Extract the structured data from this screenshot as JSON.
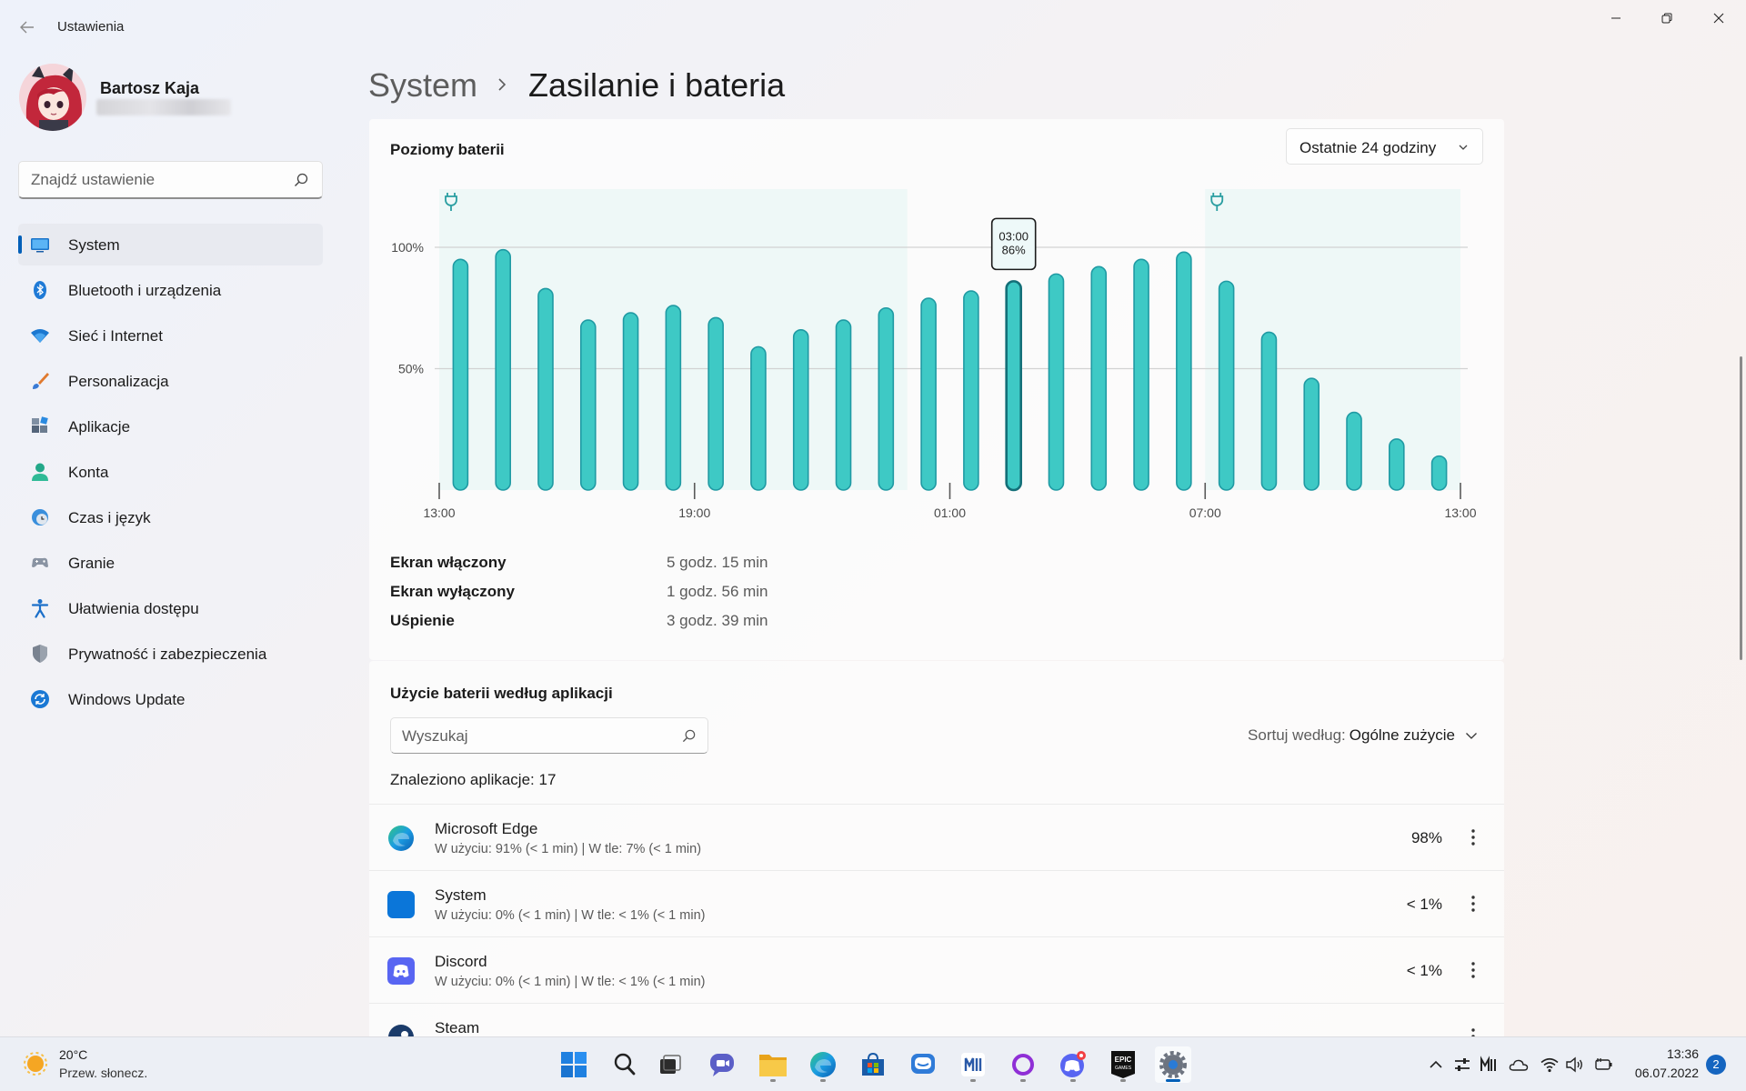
{
  "window": {
    "title": "Ustawienia"
  },
  "profile": {
    "name": "Bartosz Kaja"
  },
  "sidebar": {
    "search_placeholder": "Znajdź ustawienie",
    "items": [
      {
        "label": "System",
        "icon": "system-icon",
        "active": true
      },
      {
        "label": "Bluetooth i urządzenia",
        "icon": "bluetooth-icon"
      },
      {
        "label": "Sieć i Internet",
        "icon": "wifi-icon"
      },
      {
        "label": "Personalizacja",
        "icon": "brush-icon"
      },
      {
        "label": "Aplikacje",
        "icon": "apps-icon"
      },
      {
        "label": "Konta",
        "icon": "account-icon"
      },
      {
        "label": "Czas i język",
        "icon": "time-language-icon"
      },
      {
        "label": "Granie",
        "icon": "gamepad-icon"
      },
      {
        "label": "Ułatwienia dostępu",
        "icon": "accessibility-icon"
      },
      {
        "label": "Prywatność i zabezpieczenia",
        "icon": "shield-icon"
      },
      {
        "label": "Windows Update",
        "icon": "update-icon"
      }
    ]
  },
  "header": {
    "parent": "System",
    "current": "Zasilanie i bateria"
  },
  "battery_levels": {
    "title": "Poziomy baterii",
    "range_select": "Ostatnie 24 godziny"
  },
  "chart_data": {
    "type": "bar",
    "ylim": [
      0,
      100
    ],
    "y_ticks": [
      "100%",
      "50%"
    ],
    "y_tick_values": [
      100,
      50
    ],
    "x_ticks": [
      "13:00",
      "19:00",
      "01:00",
      "07:00",
      "13:00"
    ],
    "values": [
      95,
      99,
      83,
      70,
      73,
      76,
      71,
      59,
      66,
      70,
      75,
      79,
      82,
      86,
      89,
      92,
      95,
      98,
      86,
      65,
      46,
      32,
      21,
      14
    ],
    "highlighted_index": 13,
    "tooltip": {
      "time": "03:00",
      "value": "86%"
    },
    "charging_periods": [
      [
        0,
        11
      ],
      [
        18,
        24
      ]
    ],
    "colors": {
      "bar": "#3ec9c5",
      "bar_border": "#1f9aa3",
      "highlight_border": "#136f78",
      "charging_bg": "#eef8f7",
      "plug": "#2a9ea1"
    }
  },
  "usage": {
    "screen_on_label": "Ekran włączony",
    "screen_on_value": "5 godz. 15 min",
    "screen_off_label": "Ekran wyłączony",
    "screen_off_value": "1 godz. 56 min",
    "sleep_label": "Uśpienie",
    "sleep_value": "3 godz. 39 min"
  },
  "app_usage": {
    "title": "Użycie baterii według aplikacji",
    "search_placeholder": "Wyszukaj",
    "sort_label": "Sortuj według:",
    "sort_value": "Ogólne zużycie",
    "found": "Znaleziono aplikacje: 17",
    "apps": [
      {
        "name": "Microsoft Edge",
        "detail": "W użyciu: 91% (< 1 min) | W tle: 7% (< 1 min)",
        "percent": "98%",
        "icon": "edge-icon"
      },
      {
        "name": "System",
        "detail": "W użyciu: 0% (< 1 min) | W tle: < 1% (< 1 min)",
        "percent": "< 1%",
        "icon": "system-app-icon"
      },
      {
        "name": "Discord",
        "detail": "W użyciu: 0% (< 1 min) | W tle: < 1% (< 1 min)",
        "percent": "< 1%",
        "icon": "discord-icon"
      },
      {
        "name": "Steam",
        "detail": "",
        "percent": "",
        "icon": "steam-icon"
      }
    ]
  },
  "taskbar": {
    "weather_temp": "20°C",
    "weather_desc": "Przew. słonecz.",
    "time": "13:36",
    "date": "06.07.2022",
    "notifications": "2"
  }
}
